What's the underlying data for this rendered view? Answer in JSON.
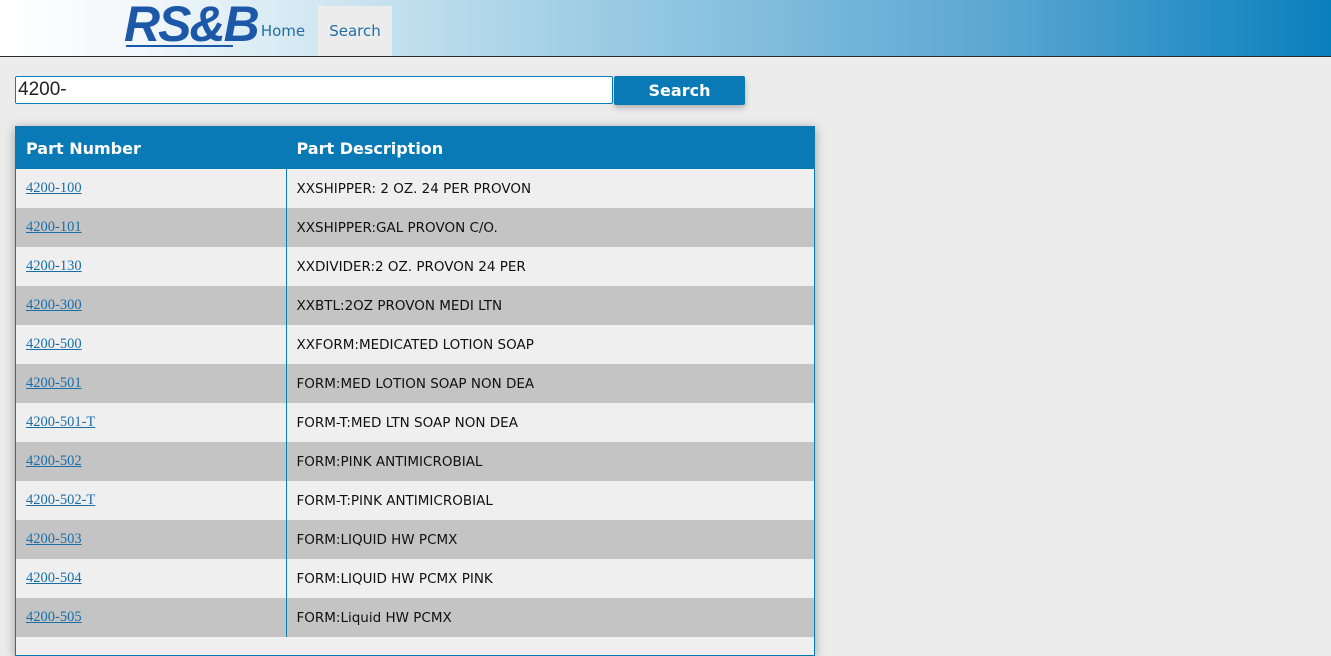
{
  "header": {
    "logo_text": "RS&B",
    "nav": [
      {
        "label": "Home"
      },
      {
        "label": "Search"
      }
    ]
  },
  "search": {
    "value": "4200-",
    "button_label": "Search"
  },
  "table": {
    "columns": [
      "Part Number",
      "Part Description"
    ],
    "rows": [
      {
        "part": "4200-100",
        "desc": "XXSHIPPER: 2 OZ. 24 PER PROVON"
      },
      {
        "part": "4200-101",
        "desc": "XXSHIPPER:GAL PROVON C/O."
      },
      {
        "part": "4200-130",
        "desc": "XXDIVIDER:2 OZ. PROVON 24 PER"
      },
      {
        "part": "4200-300",
        "desc": "XXBTL:2OZ PROVON MEDI LTN"
      },
      {
        "part": "4200-500",
        "desc": "XXFORM:MEDICATED LOTION SOAP"
      },
      {
        "part": "4200-501",
        "desc": "FORM:MED LOTION SOAP NON DEA"
      },
      {
        "part": "4200-501-T",
        "desc": "FORM-T:MED LTN SOAP NON DEA"
      },
      {
        "part": "4200-502",
        "desc": "FORM:PINK ANTIMICROBIAL"
      },
      {
        "part": "4200-502-T",
        "desc": "FORM-T:PINK ANTIMICROBIAL"
      },
      {
        "part": "4200-503",
        "desc": "FORM:LIQUID HW PCMX"
      },
      {
        "part": "4200-504",
        "desc": "FORM:LIQUID HW PCMX PINK"
      },
      {
        "part": "4200-505",
        "desc": "FORM:Liquid HW PCMX"
      }
    ]
  },
  "colors": {
    "accent": "#0a7ab6",
    "row_alt": "#c4c4c4",
    "link": "#1a6ea8"
  }
}
